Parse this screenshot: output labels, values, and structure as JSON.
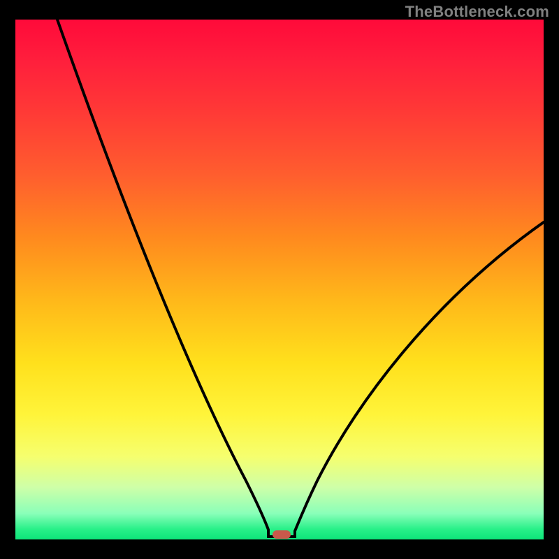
{
  "attribution": "TheBottleneck.com",
  "colors": {
    "bg": "#000000",
    "curve": "#000000",
    "marker": "#c9594b",
    "gradient_top": "#ff0a3a",
    "gradient_bottom": "#0de47a",
    "attribution_text": "#808080"
  },
  "chart_data": {
    "type": "line",
    "title": "",
    "xlabel": "",
    "ylabel": "",
    "xlim": [
      0,
      100
    ],
    "ylim": [
      0,
      100
    ],
    "x": [
      0,
      5,
      10,
      15,
      20,
      25,
      30,
      35,
      40,
      42,
      44,
      46,
      48,
      50,
      52,
      54,
      56,
      58,
      60,
      65,
      70,
      75,
      80,
      85,
      90,
      95,
      100
    ],
    "values": [
      100,
      89,
      79,
      70,
      61,
      53,
      45,
      37,
      29,
      25,
      20,
      14,
      7,
      0,
      0,
      7,
      14,
      19,
      24,
      31,
      37,
      42,
      47,
      51,
      55,
      58,
      61
    ],
    "marker_x": 51,
    "marker_y": 0,
    "annotations": []
  }
}
